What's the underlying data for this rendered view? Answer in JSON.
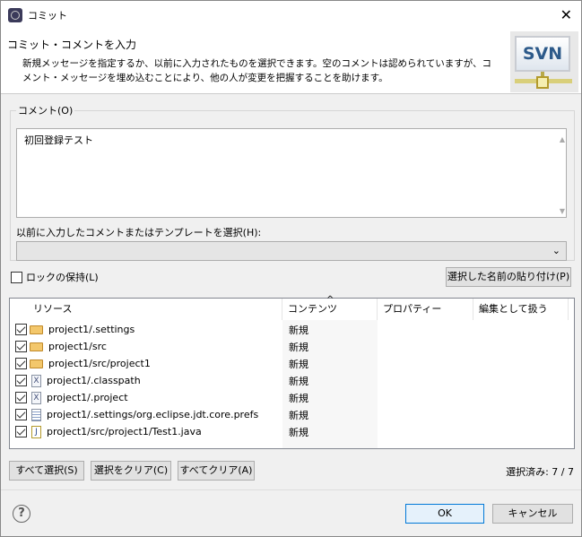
{
  "window": {
    "title": "コミット"
  },
  "header": {
    "title": "コミット・コメントを入力",
    "description": "新規メッセージを指定するか、以前に入力されたものを選択できます。空のコメントは認められていますが、コメント・メッセージを埋め込むことにより、他の人が変更を把握することを助けます。",
    "logo": "SVN"
  },
  "comment": {
    "label": "コメント(O)",
    "value": "初回登録テスト",
    "template_label": "以前に入力したコメントまたはテンプレートを選択(H):",
    "template_value": ""
  },
  "keep_locks": {
    "label": "ロックの保持(L)",
    "checked": false
  },
  "paste_names_button": "選択した名前の貼り付け(P)",
  "table": {
    "columns": [
      "リソース",
      "コンテンツ",
      "プロパティー",
      "編集として扱う"
    ],
    "rows": [
      {
        "name": "project1/.settings",
        "icon": "folder",
        "content": "新規",
        "checked": true
      },
      {
        "name": "project1/src",
        "icon": "folder",
        "content": "新規",
        "checked": true
      },
      {
        "name": "project1/src/project1",
        "icon": "folder",
        "content": "新規",
        "checked": true
      },
      {
        "name": "project1/.classpath",
        "icon": "xml-file",
        "content": "新規",
        "checked": true
      },
      {
        "name": "project1/.project",
        "icon": "xml-file",
        "content": "新規",
        "checked": true
      },
      {
        "name": "project1/.settings/org.eclipse.jdt.core.prefs",
        "icon": "text-file",
        "content": "新規",
        "checked": true
      },
      {
        "name": "project1/src/project1/Test1.java",
        "icon": "java-file",
        "content": "新規",
        "checked": true
      }
    ]
  },
  "buttons": {
    "select_all": "すべて選択(S)",
    "clear_selection": "選択をクリア(C)",
    "clear_all": "すべてクリア(A)",
    "ok": "OK",
    "cancel": "キャンセル"
  },
  "selected_count": "選択済み: 7 / 7"
}
